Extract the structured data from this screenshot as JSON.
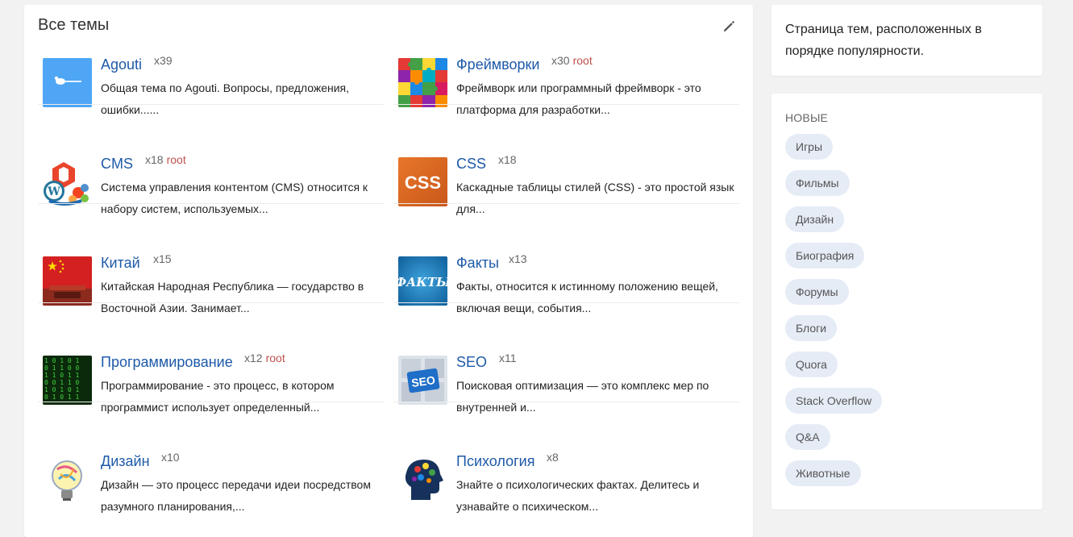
{
  "main": {
    "title": "Все темы",
    "topics": [
      {
        "name": "Agouti",
        "count": "x39",
        "root": "",
        "desc": "Общая тема по Agouti. Вопросы, предложения, ошибки......",
        "icon": "agouti-logo-icon"
      },
      {
        "name": "Фреймворки",
        "count": "x30",
        "root": "root",
        "desc": "Фреймворк или программный фреймворк - это платформа для разработки...",
        "icon": "puzzle-icon"
      },
      {
        "name": "CMS",
        "count": "x18",
        "root": "root",
        "desc": "Система управления контентом (CMS) относится к набору систем, используемых...",
        "icon": "cms-logos-icon"
      },
      {
        "name": "CSS",
        "count": "x18",
        "root": "",
        "desc": "Каскадные таблицы стилей (CSS) - это простой язык для...",
        "icon": "css-icon"
      },
      {
        "name": "Китай",
        "count": "x15",
        "root": "",
        "desc": "Китайская Народная Республика — государство в Восточной Азии. Занимает...",
        "icon": "china-flag-icon"
      },
      {
        "name": "Факты",
        "count": "x13",
        "root": "",
        "desc": "Факты, относится к истинному положению вещей, включая вещи, события...",
        "icon": "facts-icon"
      },
      {
        "name": "Программирование",
        "count": "x12",
        "root": "root",
        "desc": "Программирование - это процесс, в котором программист использует определенный...",
        "icon": "code-matrix-icon"
      },
      {
        "name": "SEO",
        "count": "x11",
        "root": "",
        "desc": "Поисковая оптимизация — это комплекс мер по внутренней и...",
        "icon": "seo-puzzle-icon"
      },
      {
        "name": "Дизайн",
        "count": "x10",
        "root": "",
        "desc": "Дизайн — это процесс передачи идеи посредством разумного планирования,...",
        "icon": "lightbulb-icon"
      },
      {
        "name": "Психология",
        "count": "x8",
        "root": "",
        "desc": "Знайте о психологических фактах. Делитесь и узнавайте о психическом...",
        "icon": "head-brain-icon"
      }
    ]
  },
  "sidebar": {
    "info_text": "Страница тем, расположенных в порядке популярности.",
    "new_heading": "НОВЫЕ",
    "tags": [
      "Игры",
      "Фильмы",
      "Дизайн",
      "Биография",
      "Форумы",
      "Блоги",
      "Quora",
      "Stack Overflow",
      "Q&A",
      "Животные"
    ]
  },
  "colors": {
    "link": "#1e5aa8",
    "root": "#c0504d",
    "tag_bg": "#e6ecf6"
  }
}
